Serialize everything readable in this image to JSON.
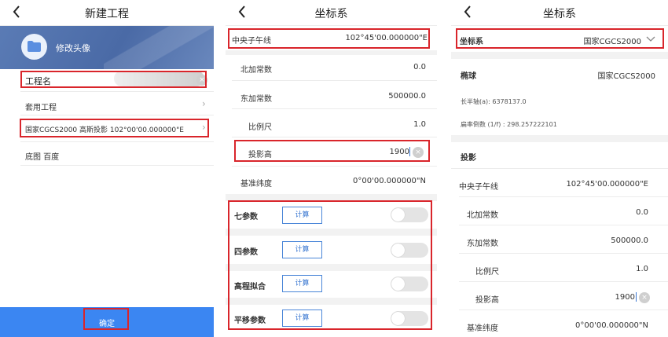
{
  "screen1": {
    "title": "新建工程",
    "avatar_label": "修改头像",
    "project_name_label": "工程名",
    "template_label": "套用工程",
    "coordinate_summary": "国家CGCS2000  高斯投影  102°00'00.000000\"E",
    "basemap_label": "底图 百度",
    "confirm_label": "确定",
    "icons": [
      "back-icon",
      "folder-icon",
      "chevron-right-icon",
      "clear-icon"
    ]
  },
  "screen2": {
    "title": "坐标系",
    "central_meridian": {
      "label": "中央子午线",
      "value": "102°45'00.000000\"E"
    },
    "false_northing": {
      "label": "北加常数",
      "value": "0.0"
    },
    "false_easting": {
      "label": "东加常数",
      "value": "500000.0"
    },
    "scale": {
      "label": "比例尺",
      "value": "1.0"
    },
    "projection_height": {
      "label": "投影高",
      "value": "1900"
    },
    "base_latitude": {
      "label": "基准纬度",
      "value": "0°00'00.000000\"N"
    },
    "params": [
      {
        "label": "七参数",
        "button": "计算"
      },
      {
        "label": "四参数",
        "button": "计算"
      },
      {
        "label": "高程拟合",
        "button": "计算"
      },
      {
        "label": "平移参数",
        "button": "计算"
      }
    ]
  },
  "screen3": {
    "title": "坐标系",
    "coord_system": {
      "label": "坐标系",
      "value": "国家CGCS2000"
    },
    "ellipsoid": {
      "label": "椭球",
      "value": "国家CGCS2000"
    },
    "semi_major": "长半轴(a): 6378137.0",
    "inverse_flattening": "扁率倒数 (1/f) : 298.257222101",
    "projection_label": "投影",
    "central_meridian": {
      "label": "中央子午线",
      "value": "102°45'00.000000\"E"
    },
    "false_northing": {
      "label": "北加常数",
      "value": "0.0"
    },
    "false_easting": {
      "label": "东加常数",
      "value": "500000.0"
    },
    "scale": {
      "label": "比例尺",
      "value": "1.0"
    },
    "projection_height": {
      "label": "投影高",
      "value": "1900"
    },
    "base_latitude": {
      "label": "基准纬度",
      "value": "0°00'00.000000\"N"
    }
  },
  "colors": {
    "accent": "#3b86f2",
    "highlight": "#d9252b",
    "banner": "#4a6aa6"
  }
}
